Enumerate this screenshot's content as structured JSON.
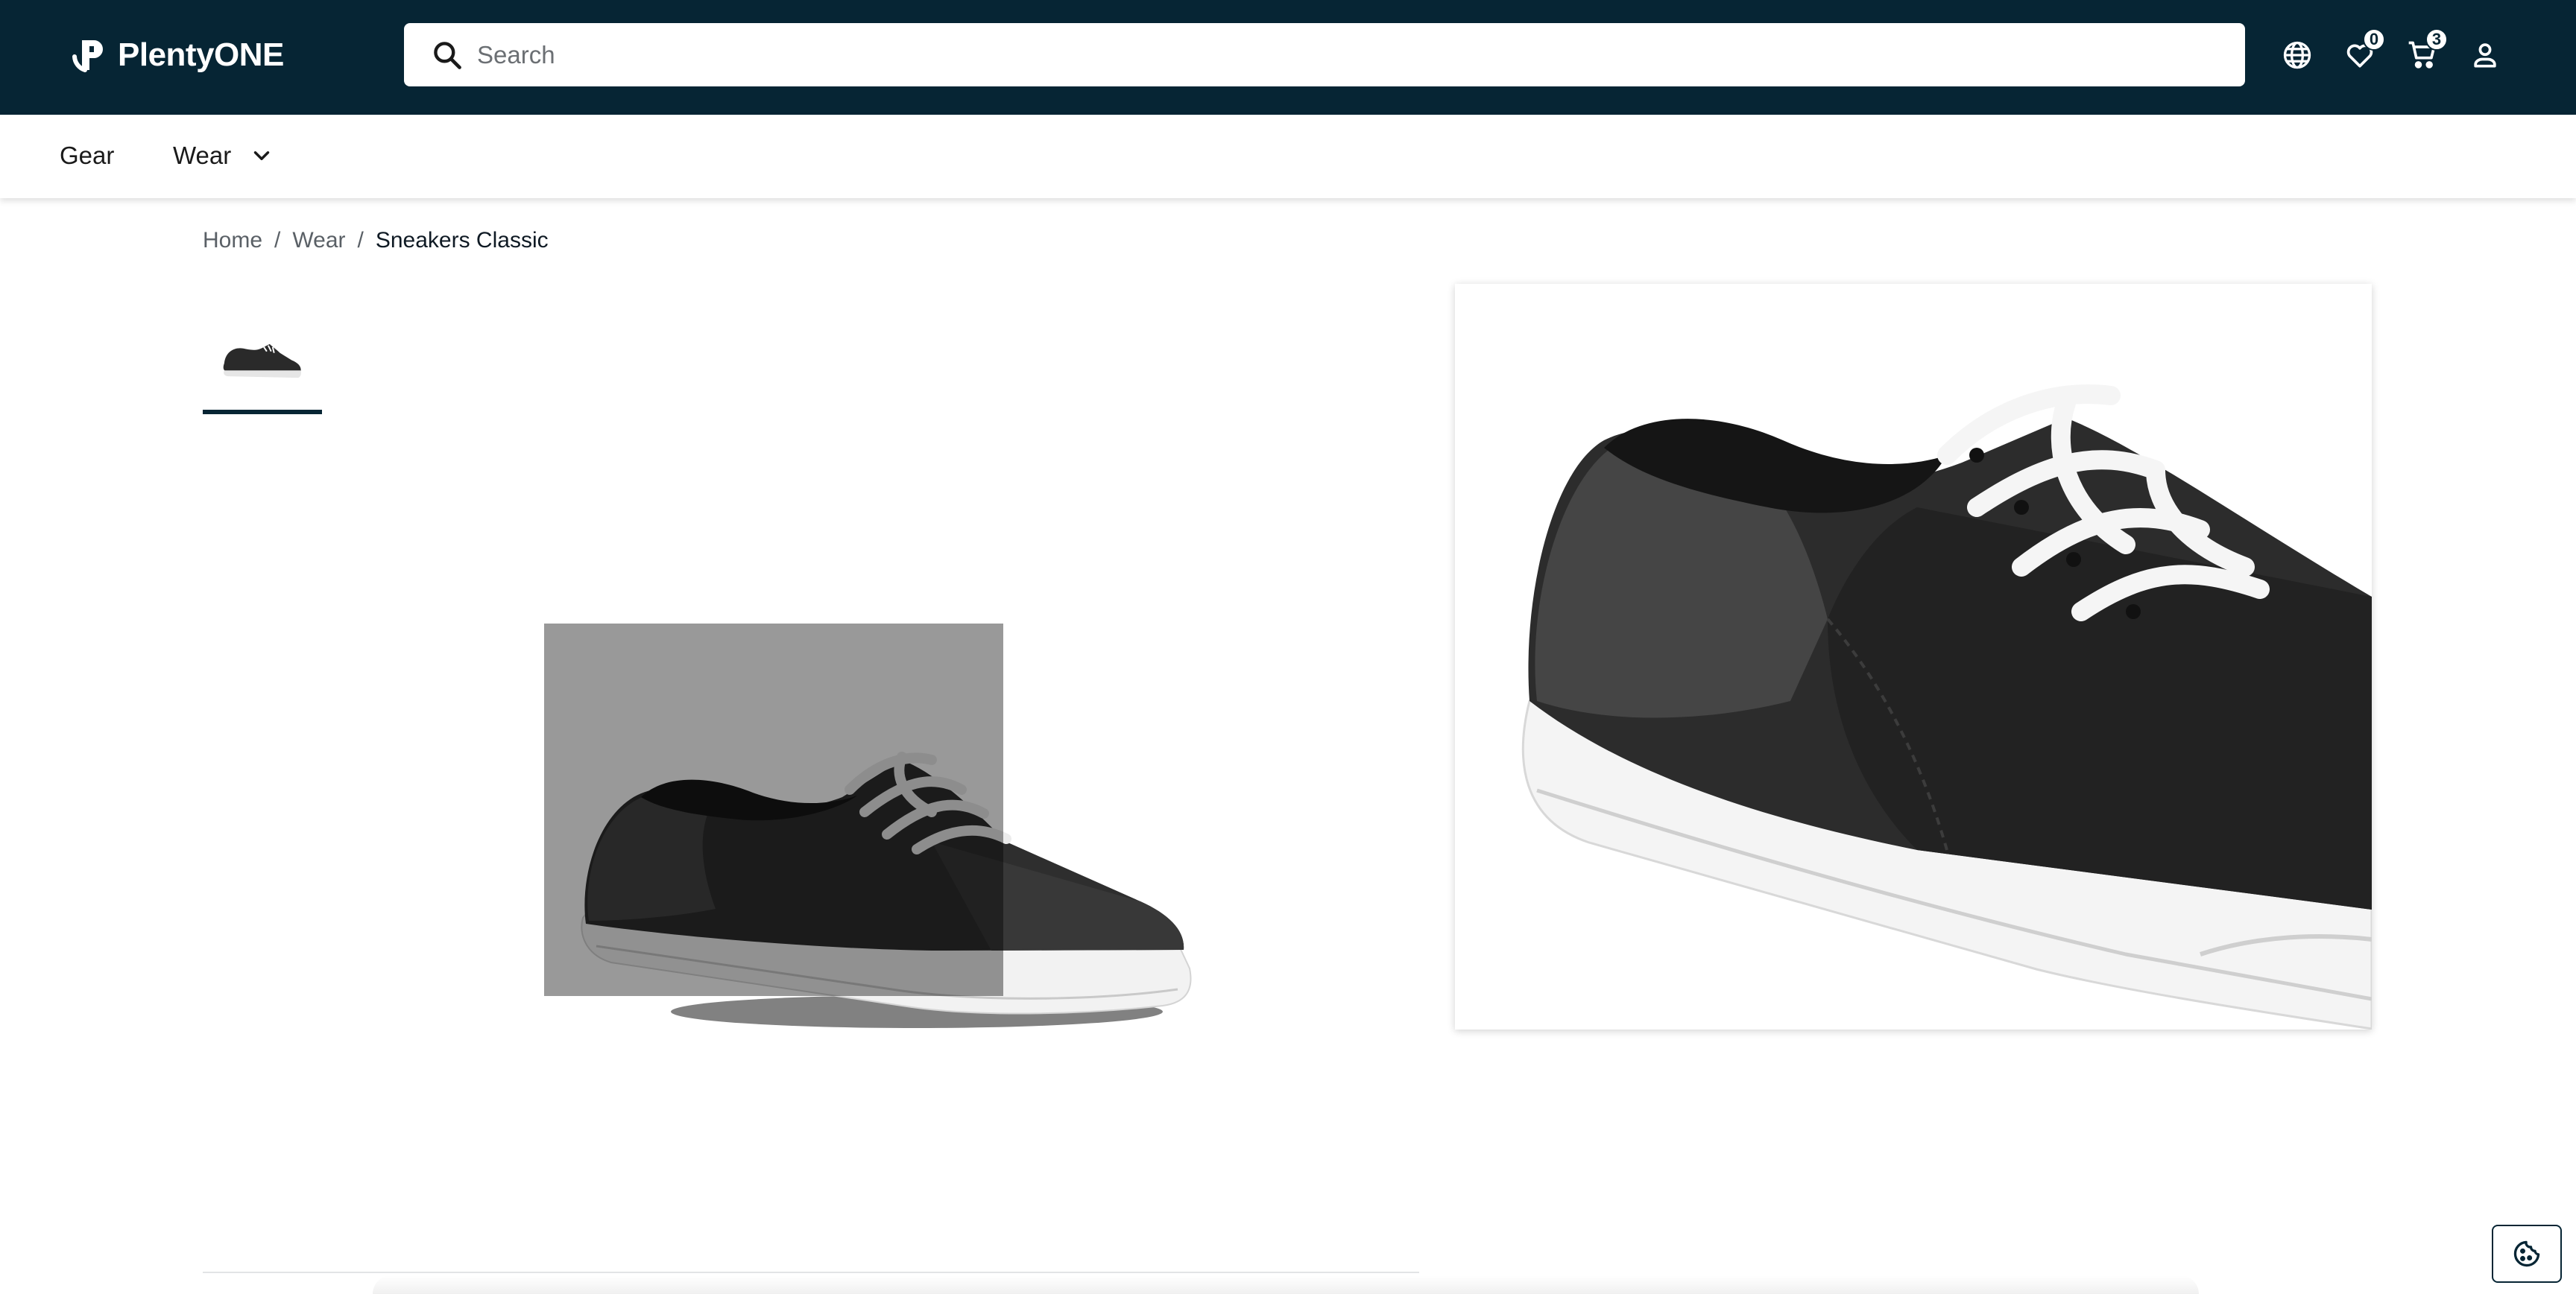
{
  "header": {
    "logo_text": "PlentyONE",
    "search_placeholder": "Search",
    "search_value": "",
    "wishlist_count": "0",
    "cart_count": "3",
    "colors": {
      "header_bg": "#062534",
      "accent": "#062534"
    }
  },
  "nav": {
    "items": [
      {
        "label": "Gear"
      },
      {
        "label": "Wear"
      }
    ]
  },
  "breadcrumb": {
    "items": [
      "Home",
      "Wear",
      "Sneakers Classic"
    ],
    "separator": "/"
  },
  "product": {
    "thumbnails": [
      {
        "icon": "sneaker-thumbnail"
      }
    ],
    "main_image_icon": "sneaker-image",
    "zoom_icon": "sneaker-zoom-image"
  },
  "cookie": {
    "icon": "cookie-icon"
  }
}
